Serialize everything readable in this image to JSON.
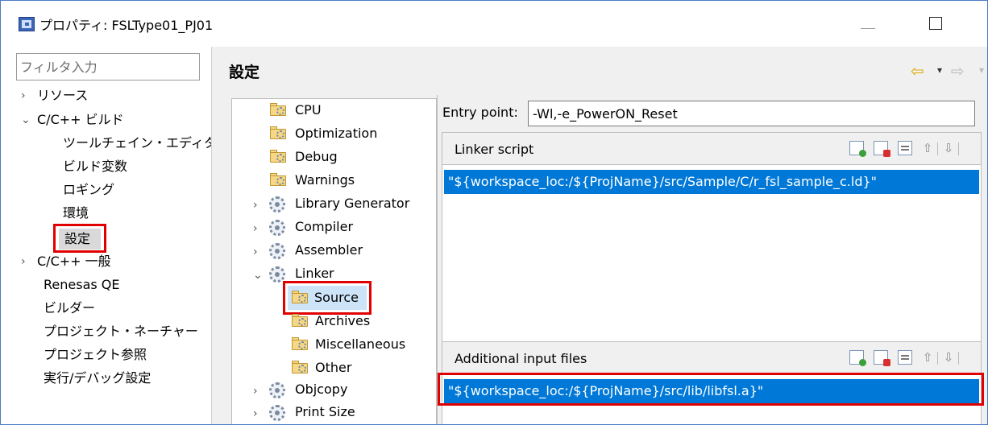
{
  "window": {
    "title": "プロパティ: FSLType01_PJ01"
  },
  "left_panel": {
    "filter_placeholder": "フィルタ入力",
    "items": [
      {
        "label": "リソース",
        "chevron": "›"
      },
      {
        "label": "C/C++ ビルド",
        "chevron": "⌄"
      },
      {
        "label": "ツールチェイン・エディター"
      },
      {
        "label": "ビルド変数"
      },
      {
        "label": "ロギング"
      },
      {
        "label": "環境"
      },
      {
        "label": "設定"
      },
      {
        "label": "C/C++ 一般",
        "chevron": "›"
      },
      {
        "label": "Renesas QE"
      },
      {
        "label": "ビルダー"
      },
      {
        "label": "プロジェクト・ネーチャー"
      },
      {
        "label": "プロジェクト参照"
      },
      {
        "label": "実行/デバッグ設定"
      }
    ]
  },
  "header": {
    "title": "設定",
    "back_icon": "⇦",
    "forward_icon": "⇨",
    "dropdown_icon": "▾"
  },
  "tool_tree": {
    "items": [
      {
        "label": "CPU"
      },
      {
        "label": "Optimization"
      },
      {
        "label": "Debug"
      },
      {
        "label": "Warnings"
      },
      {
        "label": "Library Generator",
        "chevron": "›"
      },
      {
        "label": "Compiler",
        "chevron": "›"
      },
      {
        "label": "Assembler",
        "chevron": "›"
      },
      {
        "label": "Linker",
        "chevron": "⌄"
      },
      {
        "label": "Source"
      },
      {
        "label": "Archives"
      },
      {
        "label": "Miscellaneous"
      },
      {
        "label": "Other"
      },
      {
        "label": "Objcopy",
        "chevron": "›"
      },
      {
        "label": "Print Size",
        "chevron": "›"
      }
    ]
  },
  "entry_point": {
    "label": "Entry point:",
    "value": "-Wl,-e_PowerON_Reset"
  },
  "linker_script": {
    "title": "Linker script",
    "selected_value": "\"${workspace_loc:/${ProjName}/src/Sample/C/r_fsl_sample_c.ld}\""
  },
  "additional_input_files": {
    "title": "Additional input files",
    "selected_value": "\"${workspace_loc:/${ProjName}/src/lib/libfsl.a}\""
  },
  "toolbar_icons": {
    "up": "⇧",
    "down": "⇩"
  },
  "colors": {
    "selection": "#0078d7",
    "highlight_red": "#e00000",
    "panel_bg": "#f0f0f0"
  }
}
